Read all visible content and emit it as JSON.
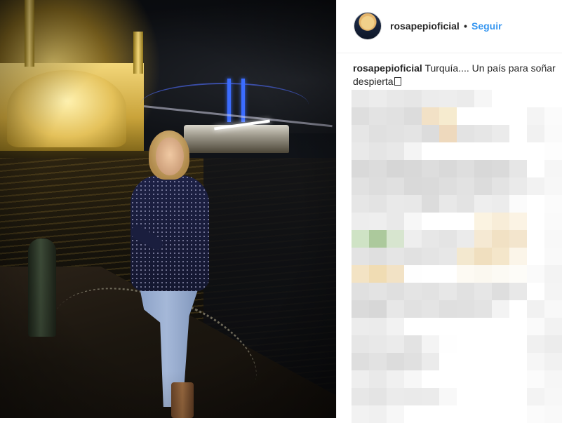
{
  "post": {
    "username": "rosapepioficial",
    "separator": "•",
    "follow_label": "Seguir",
    "caption_user": "rosapepioficial",
    "caption_text": "Turquía.... Un país para soñar despierta"
  },
  "colors": {
    "accent_blue": "#3897f0",
    "text": "#262626",
    "divider": "#efefef"
  },
  "icons": {
    "caption_glyph": "missing-emoji-glyph"
  },
  "pixelated_rows": [
    [
      "#e9e9e9",
      "#ececec",
      "#e8e8e8",
      "#e6e6e6",
      "#ececec",
      "#ededed",
      "#ebebeb",
      "#f6f6f6",
      "#ffffff",
      "#ffffff",
      "#ffffff",
      "#ffffff"
    ],
    [
      "#dedede",
      "#e3e3e3",
      "#e1e1e1",
      "#dcdcdc",
      "#f2e1c6",
      "#f6ebcf",
      "#ffffff",
      "#ffffff",
      "#ffffff",
      "#ffffff",
      "#f4f4f4",
      "#fbfbfb"
    ],
    [
      "#e6e6e6",
      "#e0e0e0",
      "#e2e2e2",
      "#e4e4e4",
      "#dcdcdc",
      "#eed9bd",
      "#e3e3e3",
      "#e6e6e6",
      "#ebebeb",
      "#ffffff",
      "#f1f1f1",
      "#fafafa"
    ],
    [
      "#e9e9e9",
      "#e5e5e5",
      "#e8e8e8",
      "#f4f4f4",
      "#ffffff",
      "#ffffff",
      "#ffffff",
      "#ffffff",
      "#ffffff",
      "#ffffff",
      "#ffffff",
      "#fdfdfd"
    ],
    [
      "#d9d9d9",
      "#dcdcdc",
      "#d6d6d6",
      "#d8d8d8",
      "#dddddd",
      "#d9d9d9",
      "#dedede",
      "#d8d8d8",
      "#dadada",
      "#e6e6e6",
      "#ffffff",
      "#f6f6f6"
    ],
    [
      "#e1e1e1",
      "#dddddd",
      "#e0e0e0",
      "#d9d9d9",
      "#dadada",
      "#dedede",
      "#e2e2e2",
      "#dcdcdc",
      "#e3e3e3",
      "#eaeaea",
      "#f2f2f2",
      "#f7f7f7"
    ],
    [
      "#e6e6e6",
      "#e3e3e3",
      "#e9e9e9",
      "#e8e8e8",
      "#dcdcdc",
      "#e8e8e8",
      "#e3e3e3",
      "#eeeeee",
      "#ececec",
      "#fbfbfb",
      "#ffffff",
      "#fbfbfb"
    ],
    [
      "#ededed",
      "#eeeeee",
      "#e9e9e9",
      "#f7f7f7",
      "#ffffff",
      "#ffffff",
      "#ffffff",
      "#fbf3e1",
      "#f8edd8",
      "#fbf3e4",
      "#ffffff",
      "#fafafa"
    ],
    [
      "#cfe3c5",
      "#acc99c",
      "#d7e5cf",
      "#eeeeee",
      "#e7e7e7",
      "#e4e4e4",
      "#ebebeb",
      "#f5e9d3",
      "#f1e1c4",
      "#f3e5cd",
      "#ffffff",
      "#f8f8f8"
    ],
    [
      "#e3e3e3",
      "#dfdfdf",
      "#e5e5e5",
      "#e1e1e1",
      "#e4e4e4",
      "#e7e7e7",
      "#f3e8cf",
      "#f0dfbf",
      "#f4e6ca",
      "#fbf5e9",
      "#ffffff",
      "#f9f9f9"
    ],
    [
      "#f3e3c4",
      "#f0dcb3",
      "#f2e2c5",
      "#fefefe",
      "#ffffff",
      "#ffffff",
      "#fdfaf3",
      "#fbf8f0",
      "#fcfaf4",
      "#fdfcf8",
      "#fafafa",
      "#f3f3f3"
    ],
    [
      "#e0e0e0",
      "#e3e3e3",
      "#dfdfdf",
      "#e4e4e4",
      "#e2e2e2",
      "#e7e7e7",
      "#e1e1e1",
      "#e6e6e6",
      "#dedede",
      "#e8e8e8",
      "#ffffff",
      "#f4f4f4"
    ],
    [
      "#dadada",
      "#d7d7d7",
      "#e7e7e7",
      "#e1e1e1",
      "#e4e4e4",
      "#dfdfdf",
      "#e0e0e0",
      "#e3e3e3",
      "#f3f3f3",
      "#ffffff",
      "#f1f1f1",
      "#f8f8f8"
    ],
    [
      "#ececec",
      "#ebebeb",
      "#f2f2f2",
      "#ffffff",
      "#ffffff",
      "#ffffff",
      "#ffffff",
      "#ffffff",
      "#ffffff",
      "#ffffff",
      "#fafafa",
      "#f2f2f2"
    ],
    [
      "#e6e6e6",
      "#e8e8e8",
      "#ebebeb",
      "#e3e3e3",
      "#f4f4f4",
      "#fefefe",
      "#ffffff",
      "#ffffff",
      "#ffffff",
      "#ffffff",
      "#f0f0f0",
      "#ececec"
    ],
    [
      "#dedede",
      "#e2e2e2",
      "#dcdcdc",
      "#e0e0e0",
      "#ebebeb",
      "#ffffff",
      "#ffffff",
      "#ffffff",
      "#ffffff",
      "#ffffff",
      "#f6f6f6",
      "#f1f1f1"
    ],
    [
      "#eeeeee",
      "#e9e9e9",
      "#f0f0f0",
      "#f7f7f7",
      "#ffffff",
      "#ffffff",
      "#ffffff",
      "#ffffff",
      "#ffffff",
      "#ffffff",
      "#fbfbfb",
      "#f6f6f6"
    ],
    [
      "#e7e7e7",
      "#e4e4e4",
      "#ebebeb",
      "#eaeaea",
      "#ebebeb",
      "#f8f8f8",
      "#ffffff",
      "#ffffff",
      "#ffffff",
      "#ffffff",
      "#f3f3f3",
      "#f7f7f7"
    ],
    [
      "#f2f2f2",
      "#f0f0f0",
      "#f7f7f7",
      "#ffffff",
      "#ffffff",
      "#ffffff",
      "#ffffff",
      "#ffffff",
      "#ffffff",
      "#ffffff",
      "#fbfbfb",
      "#f9f9f9"
    ]
  ]
}
